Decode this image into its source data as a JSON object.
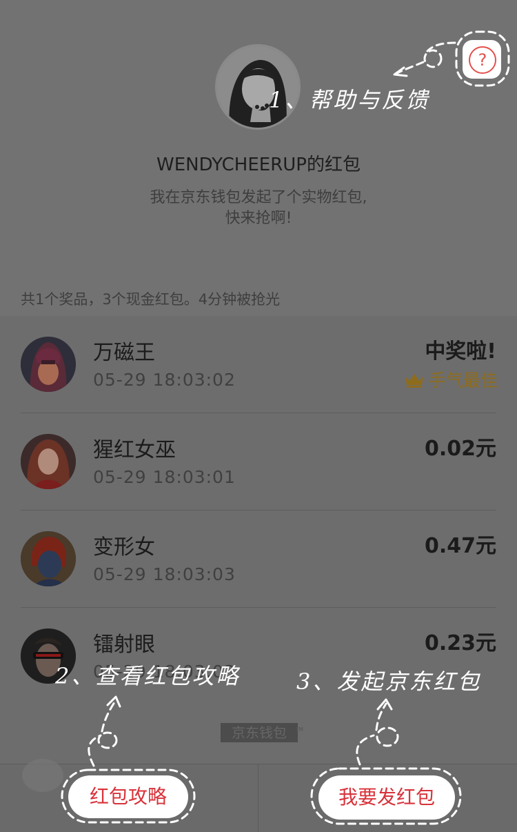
{
  "header": {
    "owner_title": "WENDYCHEERUP的红包",
    "subtitle_line1": "我在京东钱包发起了个实物红包,",
    "subtitle_line2": "快来抢啊!",
    "summary": "共1个奖品，3个现金红包。4分钟被抢光"
  },
  "list": [
    {
      "name": "万磁王",
      "time": "05-29   18:03:02",
      "amount": "中奖啦!",
      "badge": "手气最佳"
    },
    {
      "name": "猩红女巫",
      "time": "05-29   18:03:01",
      "amount": "0.02元",
      "badge": ""
    },
    {
      "name": "变形女",
      "time": "05-29   18:03:03",
      "amount": "0.47元",
      "badge": ""
    },
    {
      "name": "镭射眼",
      "time": "05-29   18:03:03",
      "amount": "0.23元",
      "badge": ""
    }
  ],
  "footer": {
    "logo_text": "京东钱包",
    "strategy_button": "红包攻略",
    "send_button": "我要发红包"
  },
  "help": {
    "icon_glyph": "?"
  },
  "annotations": {
    "note1": "1、帮助与反馈",
    "note2": "2、查看红包攻略",
    "note3": "3、发起京东红包"
  },
  "colors": {
    "accent_red": "#d8323a",
    "gold": "#8e6c1e",
    "overlay_gray": "#6f6f6f"
  },
  "icons": {
    "help": "question-circle-icon",
    "crown": "crown-icon"
  }
}
